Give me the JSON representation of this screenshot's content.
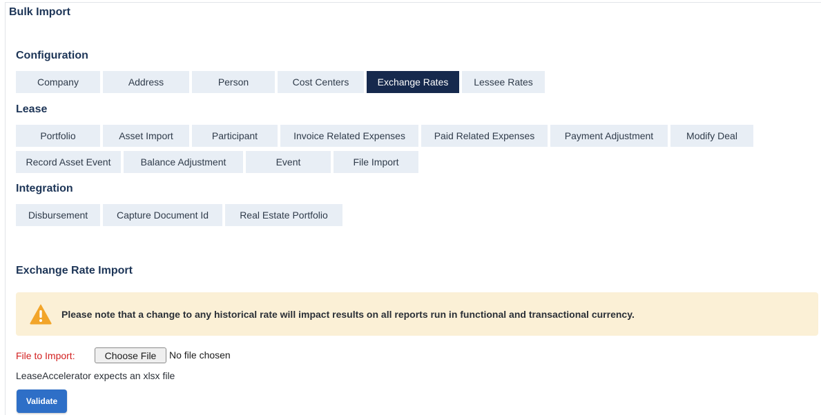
{
  "page": {
    "title": "Bulk Import"
  },
  "configuration": {
    "heading": "Configuration",
    "tabs": [
      {
        "label": "Company"
      },
      {
        "label": "Address"
      },
      {
        "label": "Person"
      },
      {
        "label": "Cost Centers"
      },
      {
        "label": "Exchange Rates",
        "active": true
      },
      {
        "label": "Lessee Rates"
      }
    ]
  },
  "lease": {
    "heading": "Lease",
    "row1": [
      {
        "label": "Portfolio"
      },
      {
        "label": "Asset Import"
      },
      {
        "label": "Participant"
      },
      {
        "label": "Invoice Related Expenses"
      },
      {
        "label": "Paid Related Expenses"
      },
      {
        "label": "Payment Adjustment"
      },
      {
        "label": "Modify Deal"
      }
    ],
    "row2": [
      {
        "label": "Record Asset Event"
      },
      {
        "label": "Balance Adjustment"
      },
      {
        "label": "Event"
      },
      {
        "label": "File Import"
      }
    ]
  },
  "integration": {
    "heading": "Integration",
    "tabs": [
      {
        "label": "Disbursement"
      },
      {
        "label": "Capture Document Id"
      },
      {
        "label": "Real Estate Portfolio"
      }
    ]
  },
  "import_section": {
    "heading": "Exchange Rate Import",
    "notice": "Please note that a change to any historical rate will impact results on all reports run in functional and transactional currency.",
    "notice_icon": "warning-icon",
    "file_label": "File to Import:",
    "choose_button": "Choose File",
    "no_file_text": "No file chosen",
    "expects_text": "LeaseAccelerator expects an xlsx file",
    "validate_button": "Validate"
  },
  "colors": {
    "active_tab": "#16294d",
    "tab_bg": "#e8eef5",
    "notice_bg": "#fbf0d6",
    "warning": "#f2a52a",
    "required_label": "#d21f1f",
    "primary_button": "#2e6fc7"
  }
}
